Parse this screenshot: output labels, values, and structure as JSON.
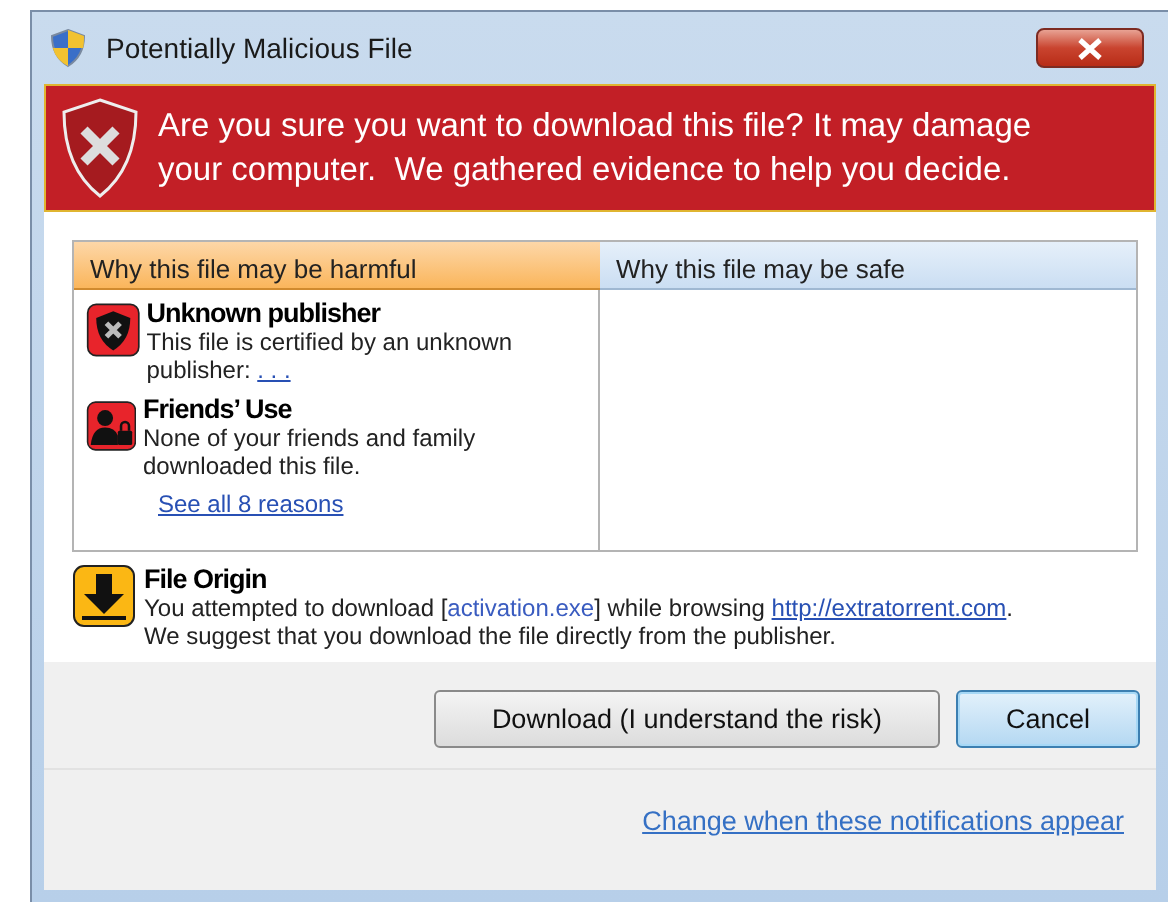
{
  "window": {
    "title": "Potentially Malicious File"
  },
  "banner": {
    "message": "Are you sure you want to download this file? It may damage your computer.  We gathered evidence to help you decide."
  },
  "tabs": [
    {
      "label": "Why this file may be harmful",
      "selected": true,
      "kind": "harmful"
    },
    {
      "label": "Why this file may be safe",
      "selected": false,
      "kind": "safe"
    }
  ],
  "reasons": [
    {
      "kind": "publisher",
      "title": "Unknown publisher",
      "text": "This file is certified by an unknown publisher: ",
      "link": ". . ."
    },
    {
      "kind": "friends",
      "title": "Friends’ Use",
      "text": "None of your friends and family downloaded this file."
    }
  ],
  "see_all_link": "See all 8 reasons",
  "origin": {
    "title": "File Origin",
    "before": "You attempted to download [",
    "file": "activation.exe",
    "middle": "] while browsing ",
    "link": "http://extratorrent.com",
    "after": ".",
    "line_2": "We suggest that you download the file directly from the publisher."
  },
  "buttons": [
    {
      "label": "Download (I understand the risk)",
      "kind": "normal"
    },
    {
      "label": "Cancel",
      "kind": "default"
    }
  ],
  "footer_link": "Change when these notifications appear"
}
